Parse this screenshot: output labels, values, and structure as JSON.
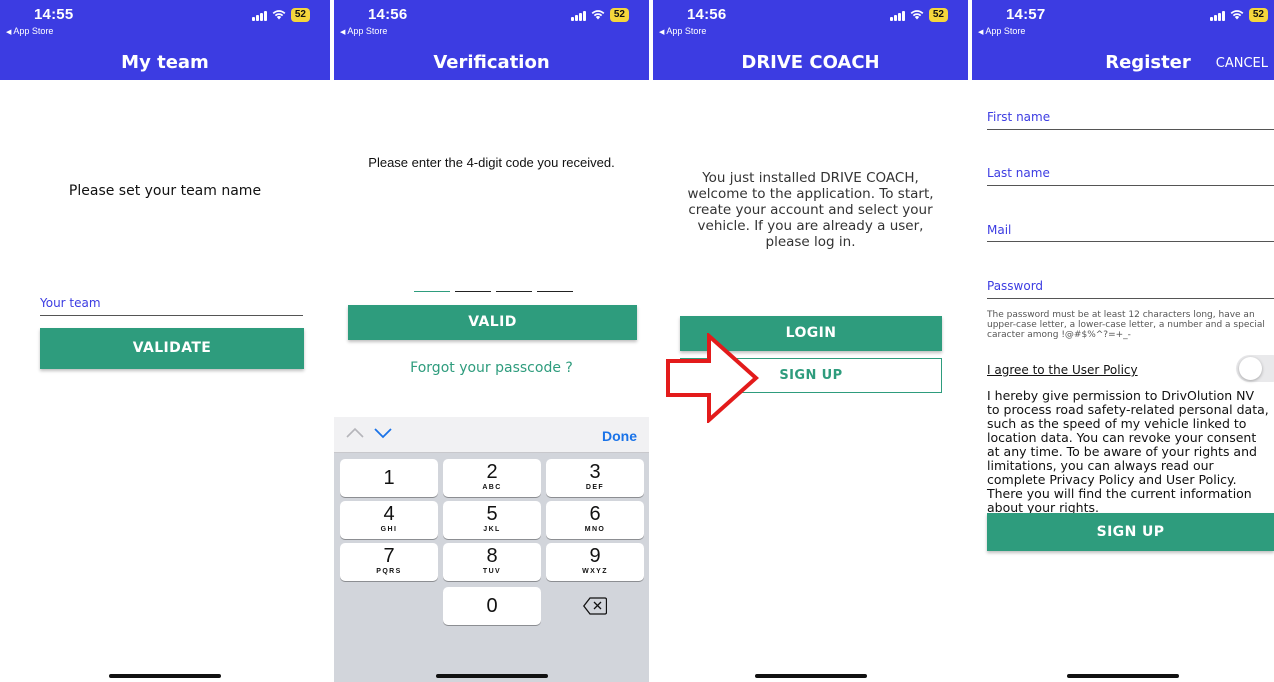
{
  "colors": {
    "header": "#3c3ce2",
    "accent": "#2e9c7d",
    "arrow": "#e31b1b"
  },
  "screens": [
    {
      "time": "14:55",
      "back_label": "App Store",
      "battery": "52",
      "title": "My team",
      "prompt": "Please set your team name",
      "team_field_label": "Your team",
      "validate_button": "VALIDATE"
    },
    {
      "time": "14:56",
      "back_label": "App Store",
      "battery": "52",
      "title": "Verification",
      "prompt": "Please enter the 4-digit code you received.",
      "valid_button": "VALID",
      "forgot_link": "Forgot your passcode ?",
      "keyboard": {
        "done": "Done",
        "keys": [
          {
            "digit": "1",
            "letters": ""
          },
          {
            "digit": "2",
            "letters": "ABC"
          },
          {
            "digit": "3",
            "letters": "DEF"
          },
          {
            "digit": "4",
            "letters": "GHI"
          },
          {
            "digit": "5",
            "letters": "JKL"
          },
          {
            "digit": "6",
            "letters": "MNO"
          },
          {
            "digit": "7",
            "letters": "PQRS"
          },
          {
            "digit": "8",
            "letters": "TUV"
          },
          {
            "digit": "9",
            "letters": "WXYZ"
          },
          {
            "digit": "0",
            "letters": ""
          }
        ]
      }
    },
    {
      "time": "14:56",
      "back_label": "App Store",
      "battery": "52",
      "title": "DRIVE COACH",
      "welcome_text": "You just installed DRIVE COACH, welcome to the application. To start, create your account and select your vehicle. If you are already a user, please log in.",
      "login_button": "LOGIN",
      "signup_button": "SIGN UP"
    },
    {
      "time": "14:57",
      "back_label": "App Store",
      "battery": "52",
      "title": "Register",
      "cancel": "CANCEL",
      "fields": {
        "first_name": "First name",
        "last_name": "Last name",
        "mail": "Mail",
        "password": "Password"
      },
      "password_hint": "The password must be at least 12 characters long, have an upper-case letter, a lower-case letter, a number and a special caracter among !@#$%^?=+_-",
      "agree_label": "I agree to the User Policy",
      "consent_text": "I hereby give permission to DrivOlution NV to process road safety-related personal data, such as the speed of my vehicle linked to location data. You can revoke your consent at any time. To be aware of your rights and limitations, you can always read our complete Privacy Policy and User Policy. There you will find the current information about your rights.",
      "signup_button": "SIGN UP"
    }
  ]
}
